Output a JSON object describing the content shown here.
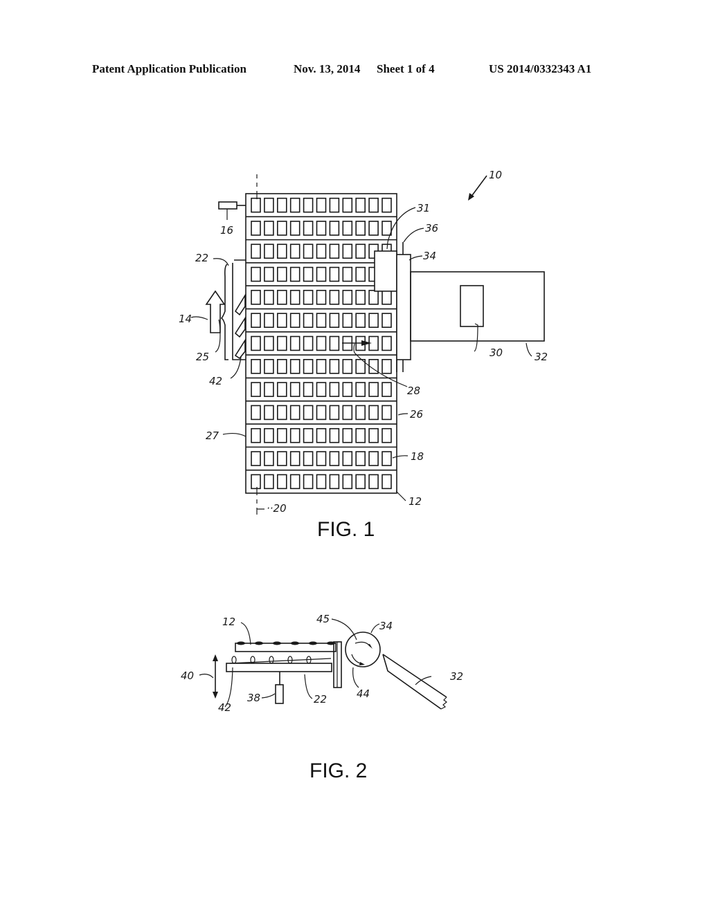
{
  "header": {
    "publication_type": "Patent Application Publication",
    "date": "Nov. 13, 2014",
    "sheet": "Sheet 1 of 4",
    "publication_number": "US 2014/0332343 A1"
  },
  "figures": [
    {
      "label": "FIG. 1",
      "grid": {
        "rows": 13,
        "columns": 11
      },
      "reference_numerals": {
        "system": "10",
        "array": "12",
        "direction_arrow": "14",
        "sensor": "16",
        "cell": "18",
        "axis": "20",
        "platform": "22",
        "platform_edge": "25",
        "row": "26",
        "array_edge": "27",
        "transfer_arrow": "28",
        "item": "30",
        "pickup_head": "31",
        "conveyor": "32",
        "roller": "34",
        "post": "36",
        "pusher": "42"
      }
    },
    {
      "label": "FIG. 2",
      "reference_numerals": {
        "array": "12",
        "platform": "22",
        "conveyor": "32",
        "roller": "34",
        "actuator": "38",
        "motion_arrow": "40",
        "pusher": "42",
        "rotation_lower": "44",
        "rotation_upper": "45"
      }
    }
  ]
}
